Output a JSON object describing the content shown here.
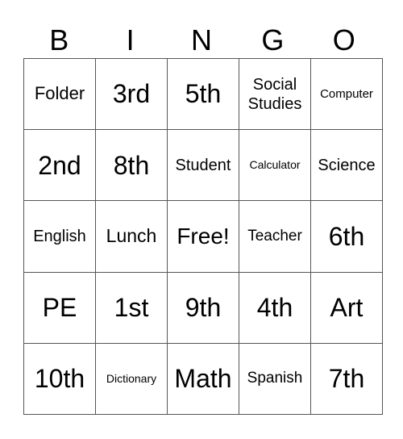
{
  "header": [
    "B",
    "I",
    "N",
    "G",
    "O"
  ],
  "cells": [
    [
      {
        "t": "Folder",
        "s": 22
      },
      {
        "t": "3rd",
        "s": 32
      },
      {
        "t": "5th",
        "s": 32
      },
      {
        "t": "Social Studies",
        "s": 20
      },
      {
        "t": "Computer",
        "s": 15
      }
    ],
    [
      {
        "t": "2nd",
        "s": 32
      },
      {
        "t": "8th",
        "s": 32
      },
      {
        "t": "Student",
        "s": 20
      },
      {
        "t": "Calculator",
        "s": 14
      },
      {
        "t": "Science",
        "s": 20
      }
    ],
    [
      {
        "t": "English",
        "s": 20
      },
      {
        "t": "Lunch",
        "s": 23
      },
      {
        "t": "Free!",
        "s": 28
      },
      {
        "t": "Teacher",
        "s": 19
      },
      {
        "t": "6th",
        "s": 32
      }
    ],
    [
      {
        "t": "PE",
        "s": 32
      },
      {
        "t": "1st",
        "s": 32
      },
      {
        "t": "9th",
        "s": 32
      },
      {
        "t": "4th",
        "s": 32
      },
      {
        "t": "Art",
        "s": 32
      }
    ],
    [
      {
        "t": "10th",
        "s": 32
      },
      {
        "t": "Dictionary",
        "s": 14
      },
      {
        "t": "Math",
        "s": 32
      },
      {
        "t": "Spanish",
        "s": 19
      },
      {
        "t": "7th",
        "s": 32
      }
    ]
  ]
}
